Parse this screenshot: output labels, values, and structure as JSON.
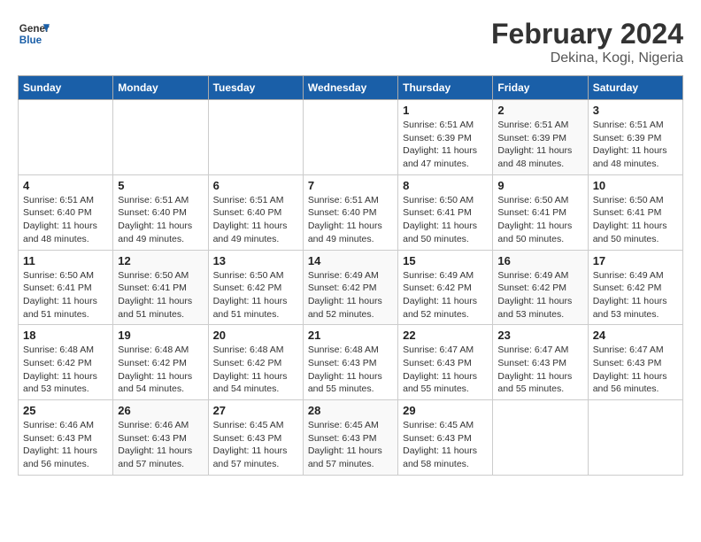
{
  "header": {
    "logo_line1": "General",
    "logo_line2": "Blue",
    "title": "February 2024",
    "subtitle": "Dekina, Kogi, Nigeria"
  },
  "weekdays": [
    "Sunday",
    "Monday",
    "Tuesday",
    "Wednesday",
    "Thursday",
    "Friday",
    "Saturday"
  ],
  "weeks": [
    [
      {
        "day": "",
        "info": ""
      },
      {
        "day": "",
        "info": ""
      },
      {
        "day": "",
        "info": ""
      },
      {
        "day": "",
        "info": ""
      },
      {
        "day": "1",
        "info": "Sunrise: 6:51 AM\nSunset: 6:39 PM\nDaylight: 11 hours and 47 minutes."
      },
      {
        "day": "2",
        "info": "Sunrise: 6:51 AM\nSunset: 6:39 PM\nDaylight: 11 hours and 48 minutes."
      },
      {
        "day": "3",
        "info": "Sunrise: 6:51 AM\nSunset: 6:39 PM\nDaylight: 11 hours and 48 minutes."
      }
    ],
    [
      {
        "day": "4",
        "info": "Sunrise: 6:51 AM\nSunset: 6:40 PM\nDaylight: 11 hours and 48 minutes."
      },
      {
        "day": "5",
        "info": "Sunrise: 6:51 AM\nSunset: 6:40 PM\nDaylight: 11 hours and 49 minutes."
      },
      {
        "day": "6",
        "info": "Sunrise: 6:51 AM\nSunset: 6:40 PM\nDaylight: 11 hours and 49 minutes."
      },
      {
        "day": "7",
        "info": "Sunrise: 6:51 AM\nSunset: 6:40 PM\nDaylight: 11 hours and 49 minutes."
      },
      {
        "day": "8",
        "info": "Sunrise: 6:50 AM\nSunset: 6:41 PM\nDaylight: 11 hours and 50 minutes."
      },
      {
        "day": "9",
        "info": "Sunrise: 6:50 AM\nSunset: 6:41 PM\nDaylight: 11 hours and 50 minutes."
      },
      {
        "day": "10",
        "info": "Sunrise: 6:50 AM\nSunset: 6:41 PM\nDaylight: 11 hours and 50 minutes."
      }
    ],
    [
      {
        "day": "11",
        "info": "Sunrise: 6:50 AM\nSunset: 6:41 PM\nDaylight: 11 hours and 51 minutes."
      },
      {
        "day": "12",
        "info": "Sunrise: 6:50 AM\nSunset: 6:41 PM\nDaylight: 11 hours and 51 minutes."
      },
      {
        "day": "13",
        "info": "Sunrise: 6:50 AM\nSunset: 6:42 PM\nDaylight: 11 hours and 51 minutes."
      },
      {
        "day": "14",
        "info": "Sunrise: 6:49 AM\nSunset: 6:42 PM\nDaylight: 11 hours and 52 minutes."
      },
      {
        "day": "15",
        "info": "Sunrise: 6:49 AM\nSunset: 6:42 PM\nDaylight: 11 hours and 52 minutes."
      },
      {
        "day": "16",
        "info": "Sunrise: 6:49 AM\nSunset: 6:42 PM\nDaylight: 11 hours and 53 minutes."
      },
      {
        "day": "17",
        "info": "Sunrise: 6:49 AM\nSunset: 6:42 PM\nDaylight: 11 hours and 53 minutes."
      }
    ],
    [
      {
        "day": "18",
        "info": "Sunrise: 6:48 AM\nSunset: 6:42 PM\nDaylight: 11 hours and 53 minutes."
      },
      {
        "day": "19",
        "info": "Sunrise: 6:48 AM\nSunset: 6:42 PM\nDaylight: 11 hours and 54 minutes."
      },
      {
        "day": "20",
        "info": "Sunrise: 6:48 AM\nSunset: 6:42 PM\nDaylight: 11 hours and 54 minutes."
      },
      {
        "day": "21",
        "info": "Sunrise: 6:48 AM\nSunset: 6:43 PM\nDaylight: 11 hours and 55 minutes."
      },
      {
        "day": "22",
        "info": "Sunrise: 6:47 AM\nSunset: 6:43 PM\nDaylight: 11 hours and 55 minutes."
      },
      {
        "day": "23",
        "info": "Sunrise: 6:47 AM\nSunset: 6:43 PM\nDaylight: 11 hours and 55 minutes."
      },
      {
        "day": "24",
        "info": "Sunrise: 6:47 AM\nSunset: 6:43 PM\nDaylight: 11 hours and 56 minutes."
      }
    ],
    [
      {
        "day": "25",
        "info": "Sunrise: 6:46 AM\nSunset: 6:43 PM\nDaylight: 11 hours and 56 minutes."
      },
      {
        "day": "26",
        "info": "Sunrise: 6:46 AM\nSunset: 6:43 PM\nDaylight: 11 hours and 57 minutes."
      },
      {
        "day": "27",
        "info": "Sunrise: 6:45 AM\nSunset: 6:43 PM\nDaylight: 11 hours and 57 minutes."
      },
      {
        "day": "28",
        "info": "Sunrise: 6:45 AM\nSunset: 6:43 PM\nDaylight: 11 hours and 57 minutes."
      },
      {
        "day": "29",
        "info": "Sunrise: 6:45 AM\nSunset: 6:43 PM\nDaylight: 11 hours and 58 minutes."
      },
      {
        "day": "",
        "info": ""
      },
      {
        "day": "",
        "info": ""
      }
    ]
  ]
}
